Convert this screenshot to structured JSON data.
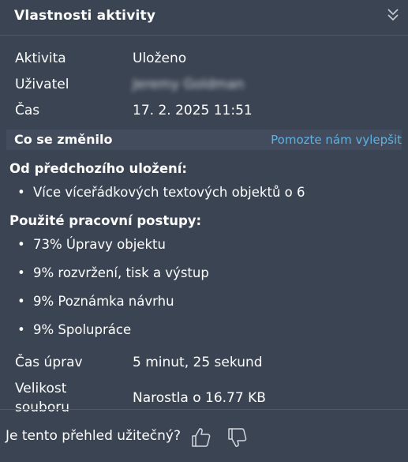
{
  "header": {
    "title": "Vlastnosti aktivity"
  },
  "props": {
    "activity_label": "Aktivita",
    "activity_value": "Uloženo",
    "user_label": "Uživatel",
    "user_value": "Jeremy Goldman",
    "time_label": "Čas",
    "time_value": "17. 2. 2025 11:51"
  },
  "changes": {
    "section_title": "Co se změnilo",
    "help_link": "Pomozte nám vylepšit",
    "since_heading": "Od předchozího uložení:",
    "since_items": [
      "Více víceřádkových textových objektů o 6"
    ],
    "workflows_heading": "Použité pracovní postupy:",
    "workflow_items": [
      "73% Úpravy objektu",
      "9% rozvržení, tisk a výstup",
      "9% Poznámka návrhu",
      "9% Spolupráce"
    ]
  },
  "stats": {
    "edit_time_label": "Čas úprav",
    "edit_time_value": "5 minut, 25 sekund",
    "file_size_label_line1": "Velikost",
    "file_size_label_line2": "souboru",
    "file_size_value": "Narostla o 16.77 KB"
  },
  "footer": {
    "question": "Je tento přehled užitečný?"
  },
  "icons": {
    "collapse": "double-chevron-down-icon",
    "like": "thumbs-up-icon",
    "dislike": "thumbs-down-icon"
  },
  "colors": {
    "background": "#3b4453",
    "link": "#59b3e6"
  }
}
